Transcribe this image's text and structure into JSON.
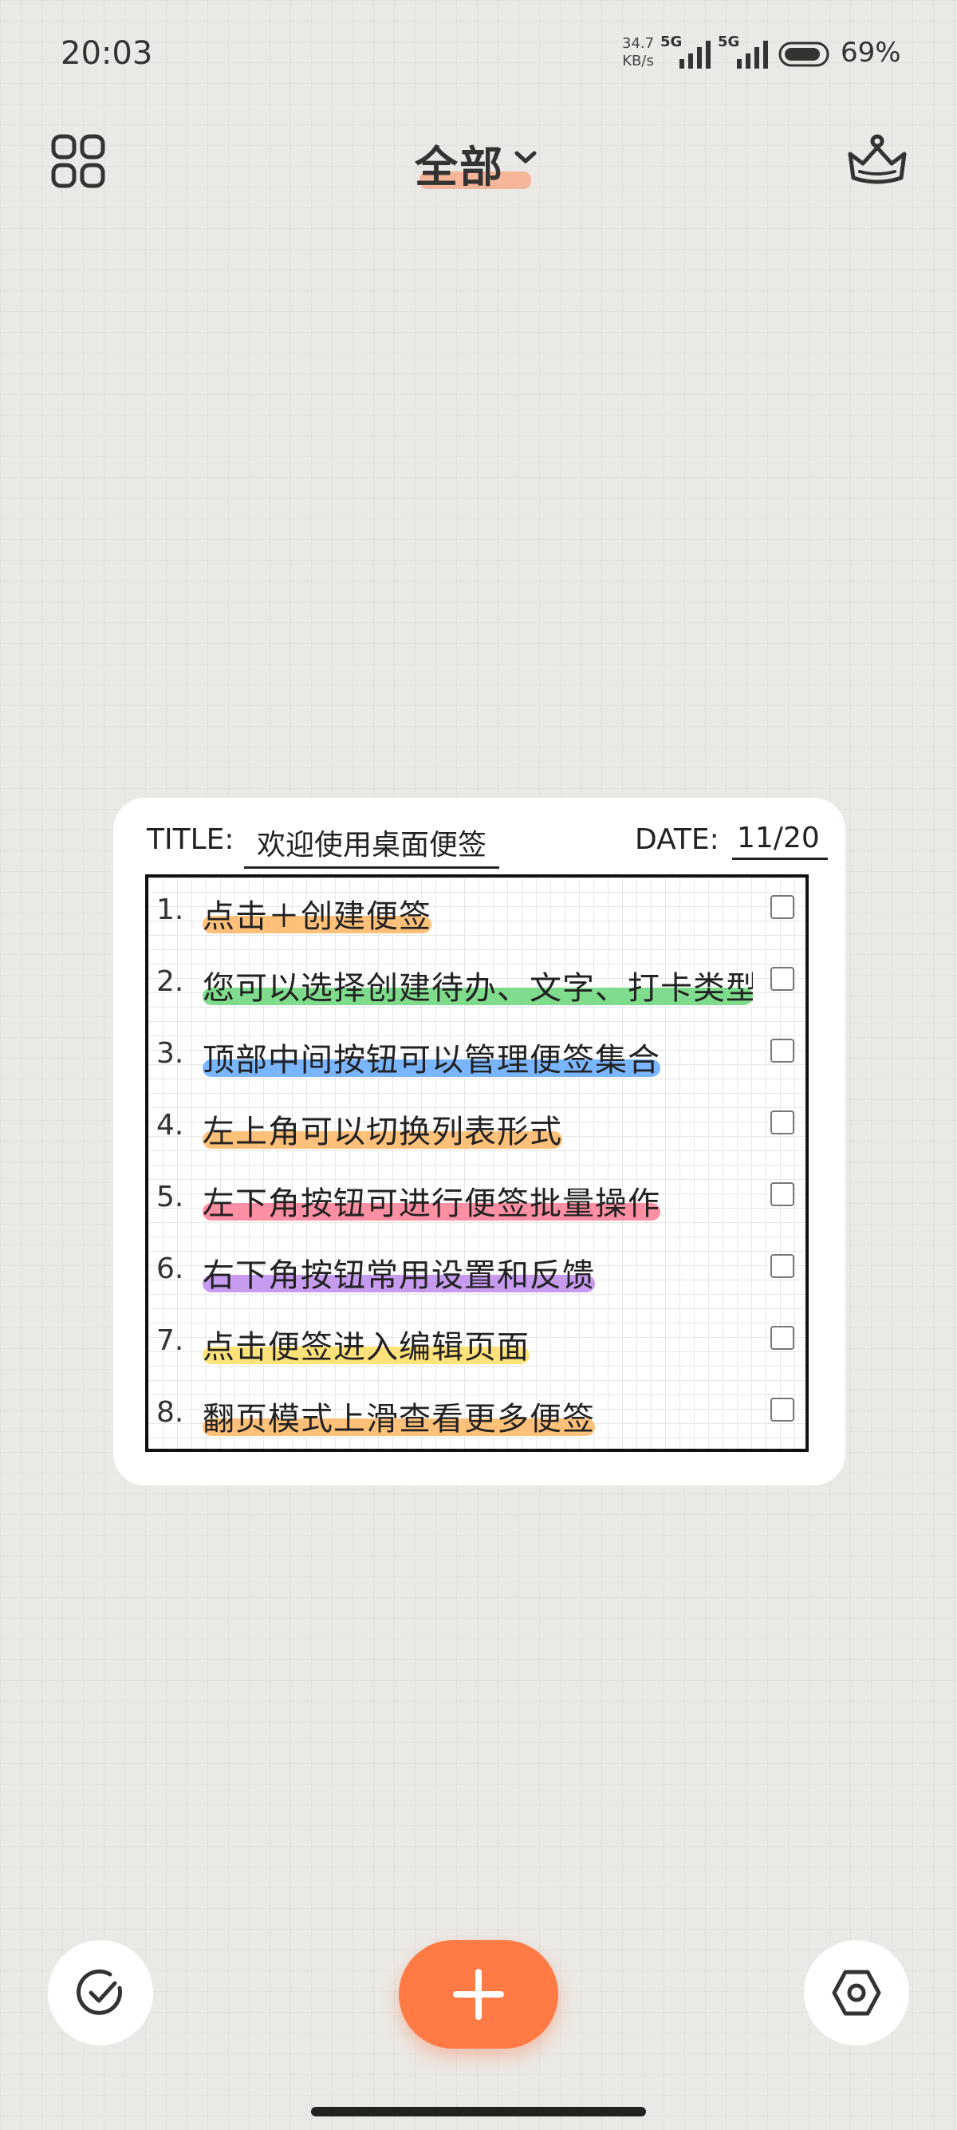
{
  "status_bar": {
    "time": "20:03",
    "net_speed_value": "34.7",
    "net_speed_unit": "KB/s",
    "sim1_label": "5G",
    "sim2_label": "5G",
    "battery_percent": "69%"
  },
  "header": {
    "title": "全部",
    "left_icon": "grid-view-icon",
    "right_icon": "crown-icon"
  },
  "card": {
    "title_label": "TITLE:",
    "title_value": "欢迎使用桌面便签",
    "date_label": "DATE:",
    "date_value": "11/20",
    "items": [
      {
        "num": "1.",
        "text": "点击＋创建便签",
        "highlight": "#ffc17a",
        "checked": false
      },
      {
        "num": "2.",
        "text": "您可以选择创建待办、文字、打卡类型",
        "highlight": "#7fdc8c",
        "checked": false
      },
      {
        "num": "3.",
        "text": "顶部中间按钮可以管理便签集合",
        "highlight": "#7ab6ff",
        "checked": false
      },
      {
        "num": "4.",
        "text": "左上角可以切换列表形式",
        "highlight": "#ffc17a",
        "checked": false
      },
      {
        "num": "5.",
        "text": "左下角按钮可进行便签批量操作",
        "highlight": "#ff8fa3",
        "checked": false
      },
      {
        "num": "6.",
        "text": "右下角按钮常用设置和反馈",
        "highlight": "#c79bf0",
        "checked": false
      },
      {
        "num": "7.",
        "text": "点击便签进入编辑页面",
        "highlight": "#ffe27a",
        "checked": false
      },
      {
        "num": "8.",
        "text": "翻页模式上滑查看更多便签",
        "highlight": "#ffc17a",
        "checked": false
      }
    ]
  },
  "bottom_bar": {
    "left_icon": "check-circle-icon",
    "center_icon": "plus-icon",
    "right_icon": "settings-hex-icon",
    "fab_color": "#ff7a45"
  }
}
